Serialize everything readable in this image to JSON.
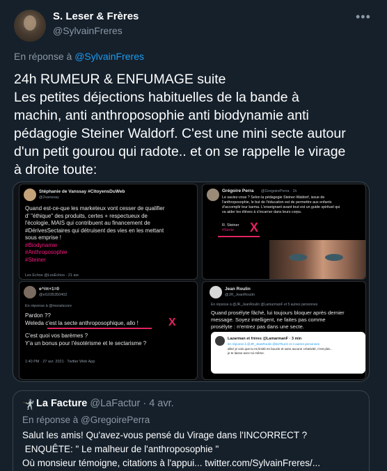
{
  "header": {
    "name": "S. Leser & Frères",
    "handle": "@SylvainFreres",
    "more_icon": "•••"
  },
  "reply_to": {
    "prefix": "En réponse à",
    "handle": "@SylvainFreres"
  },
  "tweet_lines": [
    "24h RUMEUR & ENFUMAGE suite",
    "Les petites déjections habituelles de la bande à",
    "machin, anti anthroposophie anti biodynamie anti",
    "pédagogie Steiner Waldorf. C'est une mini secte autour",
    "d'un petit gourou qui radote.. et on se rappelle le virage",
    "à droite toute:"
  ],
  "media": {
    "p1": {
      "name": "Stéphanie de Vanssay #CitoyensDuWeb",
      "handle": "@2vanssay",
      "lines": [
        "Quand est-ce-que les marketeux vont cesser de qualifier",
        "d' \"éthique\" des produits, certes + respectueux de",
        "l'écologie, MAIS qui contribuent au financement de",
        "#DérivesSectaires qui détruisent des vies en les mettant",
        "sous emprise !"
      ],
      "tags": [
        "#Biodynamie",
        "#Anthroposophie",
        "#Steiner"
      ],
      "footer": "Les Echos @LesEchos · 21 avr."
    },
    "p2": {
      "name": "Grégoire Perra",
      "handle": "@GregoirePerra · 1h",
      "lines": [
        "Le saviez-vous ? Selon la pédagogie Steiner-Waldorf, issue de",
        "l'anthroposophie, le but de l'éducation est de permettre aux enfants",
        "d'accomplir leur karma. L'enseignant avant tout est un guide spirituel qui",
        "va aider les élèves à s'incarner dans leurs corps."
      ],
      "sub_name": "R. Steiner",
      "sub_tag": "#Secte",
      "x": "X"
    },
    "p3": {
      "name": "e^iπ+1=0",
      "handle": "@el1035350402",
      "reply": "En réponse à @moralscore",
      "lines": [
        "Pardon ??",
        "Weleda c'est la secte anthroposophique, allo !",
        "",
        "C'est quoi vos barèmes ?",
        "Y'a un bonus pour l'ésotérisme et le sectarisme ?"
      ],
      "x": "X",
      "footer": "1:40 PM · 27 avr. 2021 · Twitter Web App"
    },
    "p4": {
      "name": "Jean Roulin",
      "handle": "@JR_JeanRoulin",
      "reply": "En réponse à @JR_JeanRoulin @LamarmanF et 5 autres personnes",
      "lines": [
        "Quand prosélyte fâché, lui toujours bloquer après dernier",
        "message. Soyez intelligent, ne faites pas comme",
        "prosélyte : n'entrez pas dans une secte."
      ],
      "embed_name": "Lazarman et frères @LamarmanF · 3 min",
      "embed_reply": "En réponse à @JR_JeanRoulin @ItaThuzzi et 4 autres personnes",
      "embed_line1": "allez je vois que tu es limité en boucle et sans aucune créativité, c'est plat...",
      "embed_line2": "je te laisse avec toi même."
    }
  },
  "quote": {
    "icon": "🤺",
    "name": "La Facture",
    "handle": "@LaFactur · 4 avr.",
    "reply": "En réponse à @GregoirePerra",
    "lines": [
      "Salut les amis! Qu'avez-vous pensé du Virage dans l'INCORRECT ?",
      " ENQUÊTE: \" Le malheur de l'anthroposophie \"",
      "Où monsieur témoigne, citations à l'appui...  twitter.com/SylvainFreres/..."
    ]
  },
  "colors": {
    "background": "#15202b",
    "link": "#1d9bf0",
    "secondary_text": "#8b98a5",
    "hashtag": "#f91880",
    "red_x": "#e0245e"
  }
}
